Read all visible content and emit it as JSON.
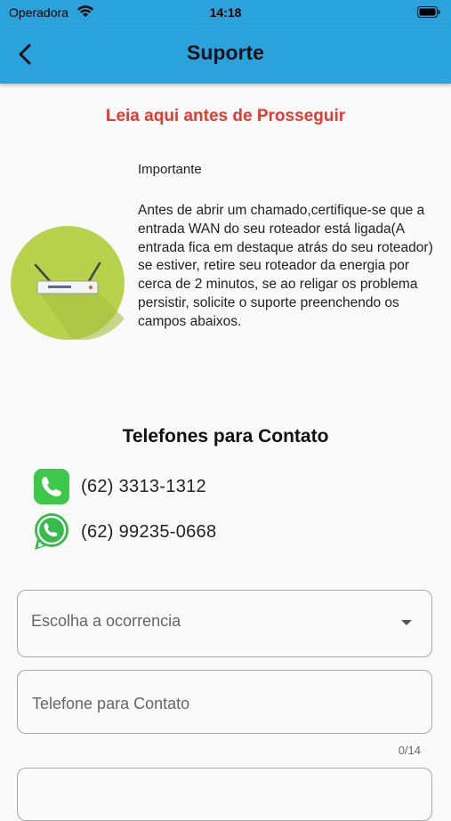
{
  "status_bar": {
    "carrier": "Operadora",
    "time": "14:18"
  },
  "app_bar": {
    "title": "Suporte"
  },
  "notice": {
    "heading": "Leia aqui antes de Prosseguir",
    "title": "Importante",
    "body": "Antes de abrir um chamado,certifique-se que a entrada WAN do seu roteador está ligada(A entrada fica em destaque atrás do seu roteador) se estiver, retire seu roteador da energia por cerca de 2 minutos, se ao religar os problema persistir, solicite o suporte preenchendo os campos abaixos."
  },
  "contacts": {
    "title": "Telefones para Contato",
    "phones": [
      {
        "icon": "phone-icon",
        "number": "(62) 3313-1312"
      },
      {
        "icon": "whatsapp-icon",
        "number": "(62) 99235-0668"
      }
    ]
  },
  "form": {
    "occurrence_placeholder": "Escolha a ocorrencia",
    "phone_placeholder": "Telefone para Contato",
    "phone_counter": "0/14"
  },
  "colors": {
    "app_bar": "#2aa3dc",
    "warning": "#e23b30",
    "phone_green": "#3ec84a",
    "circle_green": "#b8d24c"
  }
}
